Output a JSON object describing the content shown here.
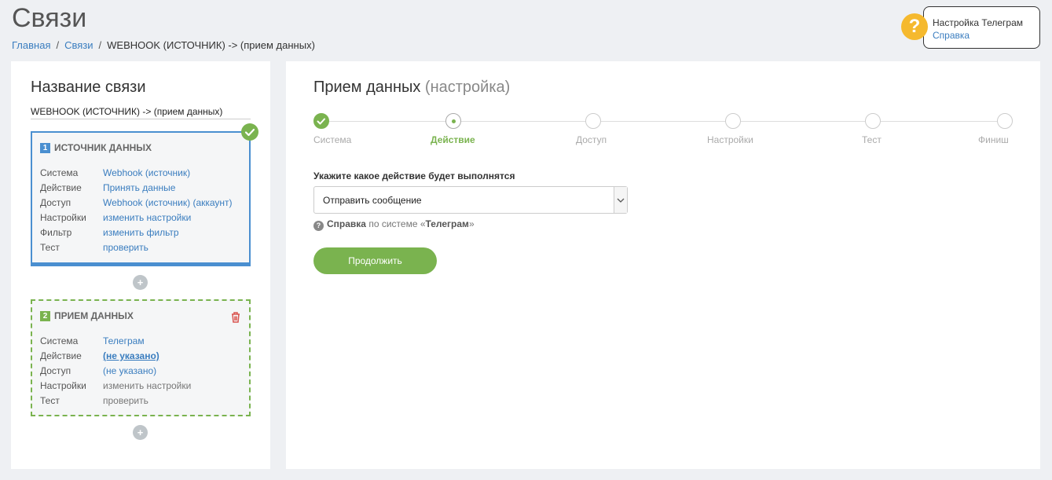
{
  "page": {
    "title": "Связи",
    "breadcrumb": {
      "home": "Главная",
      "section": "Связи",
      "current": "WEBHOOK (ИСТОЧНИК) -> (прием данных)",
      "separator": "/"
    }
  },
  "help_widget": {
    "icon": "question-icon",
    "icon_glyph": "?",
    "title": "Настройка Телеграм",
    "link": "Справка",
    "color": "#f5b92e"
  },
  "sidebar": {
    "title": "Название связи",
    "connection_name": "WEBHOOK (ИСТОЧНИК) -> (прием данных)",
    "source_card": {
      "number": "1",
      "header": "ИСТОЧНИК ДАННЫХ",
      "status_icon": "check-icon",
      "rows": [
        {
          "key": "Система",
          "value": "Webhook (источник)"
        },
        {
          "key": "Действие",
          "value": "Принять данные"
        },
        {
          "key": "Доступ",
          "value": "Webhook (источник) (аккаунт)"
        },
        {
          "key": "Настройки",
          "value": "изменить настройки"
        },
        {
          "key": "Фильтр",
          "value": "изменить фильтр"
        },
        {
          "key": "Тест",
          "value": "проверить"
        }
      ]
    },
    "dest_card": {
      "number": "2",
      "header": "ПРИЕМ ДАННЫХ",
      "delete_icon": "trash-icon",
      "rows": [
        {
          "key": "Система",
          "value": "Телеграм"
        },
        {
          "key": "Действие",
          "value": "(не указано)"
        },
        {
          "key": "Доступ",
          "value": "(не указано)"
        },
        {
          "key": "Настройки",
          "value": "изменить настройки"
        },
        {
          "key": "Тест",
          "value": "проверить"
        }
      ]
    },
    "add_glyph": "+"
  },
  "main": {
    "title": "Прием данных",
    "subtitle": "(настройка)",
    "steps": [
      {
        "label": "Система",
        "state": "done"
      },
      {
        "label": "Действие",
        "state": "active"
      },
      {
        "label": "Доступ",
        "state": "pending"
      },
      {
        "label": "Настройки",
        "state": "pending"
      },
      {
        "label": "Тест",
        "state": "pending"
      },
      {
        "label": "Финиш",
        "state": "pending"
      }
    ],
    "action_label": "Укажите какое действие будет выполнятся",
    "action_select": {
      "value": "Отправить сообщение"
    },
    "hint": {
      "icon_glyph": "?",
      "help": "Справка",
      "middle": " по системе «",
      "system": "Телеграм",
      "end": "»"
    },
    "continue_label": "Продолжить"
  },
  "colors": {
    "accent_green": "#7ab34f",
    "accent_blue": "#4a8fd0",
    "link": "#3a7dbf",
    "help_yellow": "#f5b92e",
    "danger": "#d9534f"
  }
}
